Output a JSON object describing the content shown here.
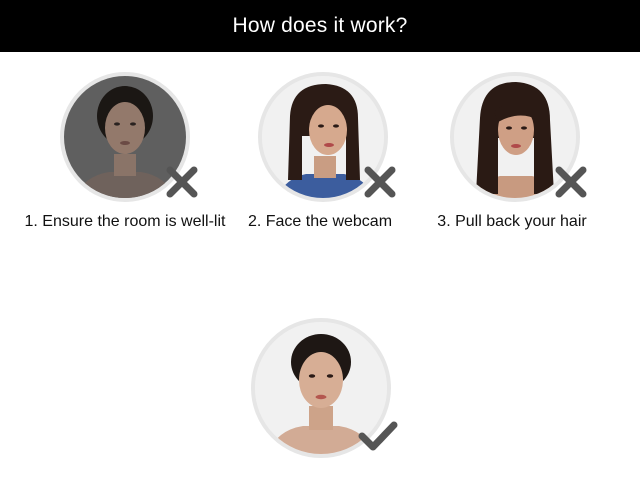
{
  "header": {
    "title": "How does it work?"
  },
  "steps": [
    {
      "caption": "1. Ensure the room is well-lit",
      "status_icon": "cross-icon"
    },
    {
      "caption": "2. Face the webcam",
      "status_icon": "cross-icon"
    },
    {
      "caption": "3. Pull back your hair",
      "status_icon": "cross-icon"
    }
  ],
  "correct_example": {
    "status_icon": "checkmark-icon"
  },
  "colors": {
    "header_background": "#000000",
    "header_text": "#ffffff",
    "mark_color": "#555555",
    "ring_color": "#e6e6e6"
  }
}
